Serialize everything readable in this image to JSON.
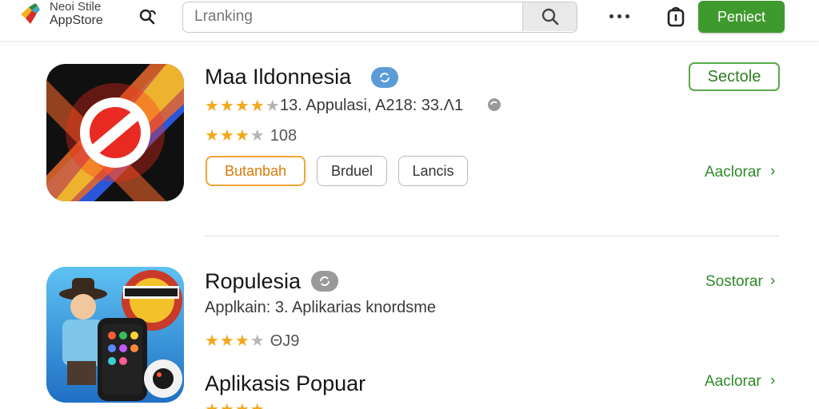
{
  "header": {
    "brand_line1": "Neoi Stile",
    "brand_line2": "AppStore",
    "search_placeholder": "Lranking",
    "primary_label": "Peniect",
    "icons": [
      "logo",
      "people-search-icon",
      "search-icon",
      "more-icon",
      "lock-icon"
    ]
  },
  "apps": [
    {
      "name": "Maa Ildonnesia",
      "meta": "13. Appulasi, A218: 33.Λ1",
      "rating_stars": 4,
      "secondary_stars": 3,
      "secondary_count": "108",
      "chips": [
        "Butanbah",
        "Brduel",
        "Lancis"
      ],
      "top_action": "Sectole",
      "link": "Aaclorar"
    },
    {
      "name": "Ropulesia",
      "meta": "Applkain: 3. Aplikarias knordsme",
      "secondary_stars": 3,
      "secondary_count": "ΘJ9",
      "link": "Sostorar"
    },
    {
      "name": "Aplikasis Popuar",
      "link": "Aaclorar"
    }
  ],
  "colors": {
    "accent_green": "#3f9a2e",
    "link_green": "#2e8a28",
    "star": "#f2a81c",
    "orange": "#f0a535",
    "badge_blue": "#5b9bd8",
    "badge_gray": "#9a9a9a"
  }
}
